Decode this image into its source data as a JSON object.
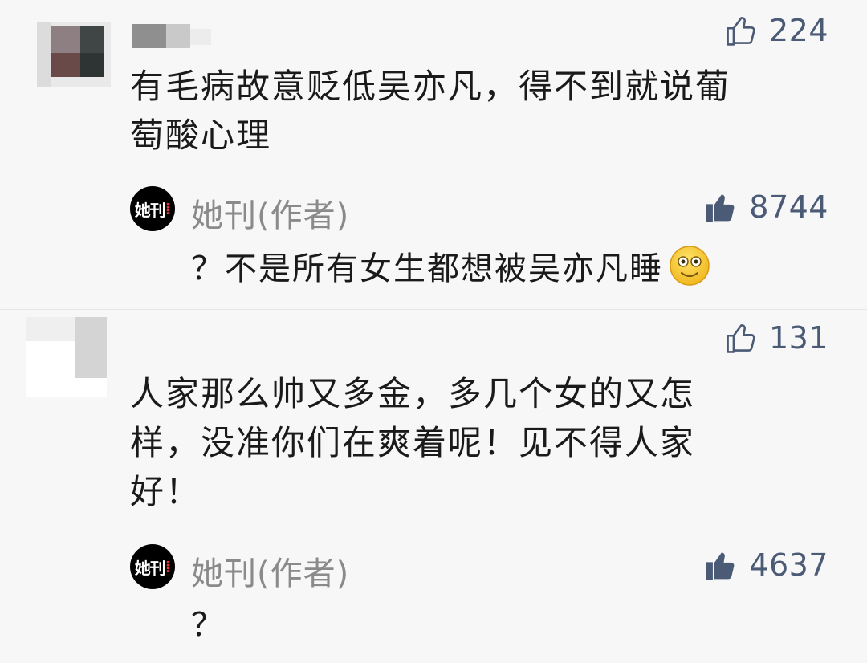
{
  "comments": [
    {
      "likes": "224",
      "text": "有毛病故意贬低吴亦凡，得不到就说葡\n萄酸心理",
      "reply": {
        "author_avatar_text": "她刊",
        "author_name": "她刊(作者)",
        "likes": "8744",
        "text": "？不是所有女生都想被吴亦凡睡",
        "emoji": "smile-icon"
      }
    },
    {
      "likes": "131",
      "text": "人家那么帅又多金，多几个女的又怎\n样，没准你们在爽着呢！见不得人家\n好！",
      "reply": {
        "author_avatar_text": "她刊",
        "author_name": "她刊(作者)",
        "likes": "4637",
        "text": "？"
      }
    }
  ],
  "colors": {
    "like_count": "#4b5a75",
    "like_filled": "#4b5a75",
    "author_name": "#8a8a8a",
    "text": "#1a1a1a",
    "background": "#f7f7f7"
  }
}
